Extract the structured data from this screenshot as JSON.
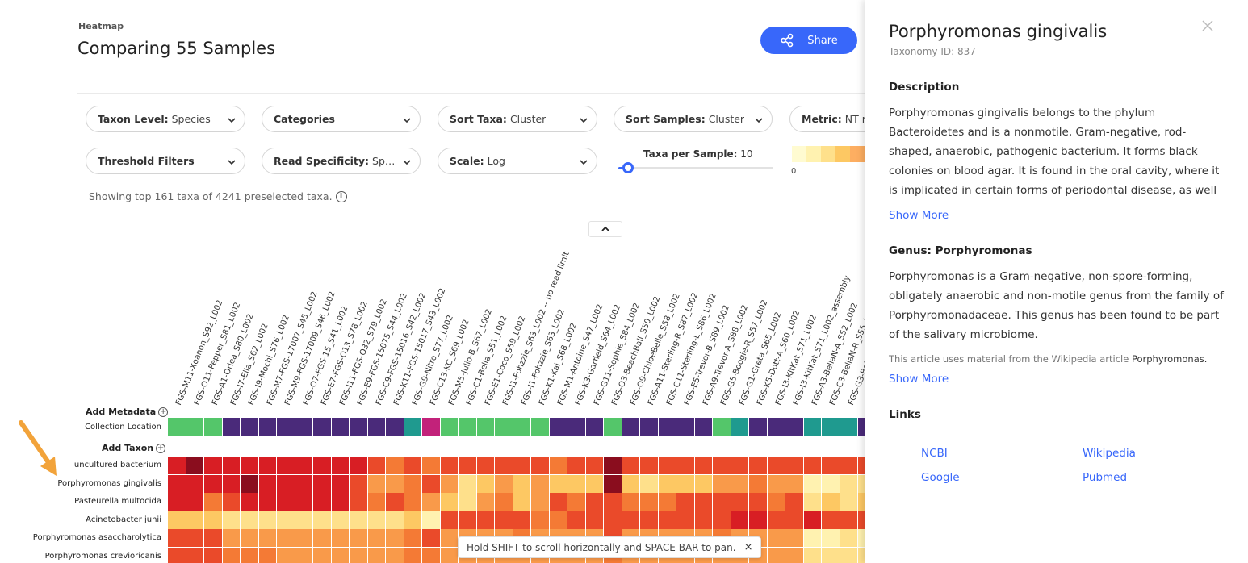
{
  "header": {
    "section_label": "Heatmap",
    "title": "Comparing 55 Samples",
    "share_label": "Share"
  },
  "controls": {
    "row1": [
      {
        "label": "Taxon Level:",
        "value": "Species"
      },
      {
        "label": "Categories",
        "value": ""
      },
      {
        "label": "Sort Taxa:",
        "value": "Cluster"
      },
      {
        "label": "Sort Samples:",
        "value": "Cluster"
      },
      {
        "label": "Metric:",
        "value": "NT r"
      }
    ],
    "row2": [
      {
        "label": "Threshold Filters",
        "value": ""
      },
      {
        "label": "Read Specificity:",
        "value": "Spec…"
      },
      {
        "label": "Scale:",
        "value": "Log"
      }
    ],
    "slider": {
      "label": "Taxa per Sample:",
      "value": "10"
    },
    "scale_zero": "0",
    "scale_colors": [
      "#fffbd1",
      "#fff2b0",
      "#fee08b",
      "#fdc863",
      "#fdae61",
      "#f98d52"
    ],
    "showing_text": "Showing top 161 taxa of 4241 preselected taxa."
  },
  "heatmap": {
    "add_metadata_label": "Add Metadata",
    "add_taxon_label": "Add Taxon",
    "metadata_row_label": "Collection Location",
    "samples": [
      "FGS-M11-Xoanon_S92_L002",
      "FGS-O11-Pepper_S81_L002",
      "FGS-A1-Orlea_S80_L002",
      "FGS-I7-Ella_S62_L002",
      "FGS-I9-Mochi_S76_L002",
      "FGS-M7-FGS-17007_S45_L002",
      "FGS-M9-FGS-17009_S46_L002",
      "FGS-O7-FGS-15_S41_L002",
      "FGS-E7-FGS-O13_S78_L002",
      "FGS-I11-FGS-O32_S79_L002",
      "FGS-E9-FGS-15075_S44_L002",
      "FGS-C9-FGS-15016_S42_L002",
      "FGS-K11-FGS-15017_S43_L002",
      "FGS-G9-Nitro_S77_L002",
      "FGS-C13-KC_S69_L002",
      "FGS-M5-Julio-B_S67_L002",
      "FGS-C1-Bella_S51_L002",
      "FGS-E1-Coco_S59_L002",
      "FGS-I1-Fohzzie_S63_L002 -- no read limit",
      "FGS-I1-Fohzzie_S63_L002",
      "FGS-K1-Kai_S68_L002",
      "FGS-M1-Antoine_S47_L002",
      "FGS-K3-Garfield_S64_L002",
      "FGS-G11-Sophie_S84_L002",
      "FGS-O3-BeachBall_S50_L002",
      "FGS-O9-ChloeBelle_S58_L002",
      "FGS-A11-Sterling-R_S87_L002",
      "FGS-C11-Sterling-L_S86_L002",
      "FGS-E5-Trevor-B_S89_L002",
      "FGS-A9-Trevor-A_S88_L002",
      "FGS-G5-Boogie-R_S57_L002",
      "FGS-G1-Greta_S65_L002",
      "FGS-K5-Dott-A_S60_L002",
      "FGS-I3-KitKat_S71_L002",
      "FGS-I3-KitKat_S71_L002_assembly",
      "FGS-A3-BellaN-A_S52_L002",
      "FGS-C3-BellaN-R_S55_L002",
      "FGS-G3-BellaN"
    ],
    "metadata_colors": [
      "#54c66a",
      "#54c66a",
      "#54c66a",
      "#4a2a7a",
      "#4a2a7a",
      "#4a2a7a",
      "#4a2a7a",
      "#4a2a7a",
      "#4a2a7a",
      "#4a2a7a",
      "#4a2a7a",
      "#4a2a7a",
      "#4a2a7a",
      "#1f9a8f",
      "#c2227a",
      "#54c66a",
      "#54c66a",
      "#54c66a",
      "#54c66a",
      "#54c66a",
      "#54c66a",
      "#4a2a7a",
      "#4a2a7a",
      "#4a2a7a",
      "#54c66a",
      "#4a2a7a",
      "#4a2a7a",
      "#4a2a7a",
      "#4a2a7a",
      "#4a2a7a",
      "#54c66a",
      "#1f9a8f",
      "#4a2a7a",
      "#4a2a7a",
      "#4a2a7a",
      "#1f9a8f",
      "#1f9a8f",
      "#1f9a8f",
      "#4a2a7a"
    ],
    "taxa": [
      {
        "name": "uncultured bacterium",
        "levels": [
          7,
          8,
          7,
          7,
          7,
          7,
          7,
          7,
          7,
          7,
          7,
          6,
          5,
          6,
          5,
          6,
          6,
          6,
          6,
          6,
          6,
          5,
          6,
          6,
          8,
          6,
          6,
          6,
          6,
          6,
          6,
          6,
          6,
          6,
          6,
          6,
          6,
          6,
          6
        ]
      },
      {
        "name": "Porphyromonas gingivalis",
        "levels": [
          7,
          7,
          7,
          7,
          8,
          7,
          7,
          7,
          7,
          7,
          6,
          4,
          4,
          5,
          6,
          4,
          2,
          3,
          4,
          3,
          4,
          3,
          3,
          3,
          8,
          3,
          2,
          3,
          3,
          3,
          4,
          4,
          5,
          4,
          4,
          1,
          1,
          2,
          2
        ]
      },
      {
        "name": "Pasteurella multocida",
        "levels": [
          7,
          7,
          5,
          6,
          7,
          7,
          7,
          7,
          7,
          7,
          6,
          5,
          6,
          5,
          4,
          3,
          2,
          4,
          5,
          3,
          4,
          6,
          5,
          6,
          6,
          5,
          5,
          5,
          6,
          6,
          6,
          6,
          6,
          5,
          6,
          2,
          3,
          2,
          3
        ]
      },
      {
        "name": "Acinetobacter junii",
        "levels": [
          3,
          3,
          3,
          2,
          2,
          2,
          2,
          2,
          2,
          2,
          2,
          2,
          2,
          3,
          1,
          6,
          6,
          6,
          6,
          6,
          5,
          5,
          6,
          6,
          6,
          6,
          6,
          6,
          6,
          6,
          6,
          7,
          7,
          6,
          6,
          7,
          6,
          6,
          6
        ]
      },
      {
        "name": "Porphyromonas asaccharolytica",
        "levels": [
          6,
          6,
          6,
          4,
          4,
          4,
          4,
          4,
          4,
          4,
          4,
          4,
          4,
          5,
          6,
          4,
          4,
          4,
          4,
          5,
          4,
          4,
          4,
          4,
          6,
          4,
          4,
          4,
          4,
          4,
          5,
          4,
          4,
          4,
          4,
          1,
          1,
          2,
          1
        ]
      },
      {
        "name": "Porphyromonas crevioricanis",
        "levels": [
          6,
          6,
          6,
          5,
          5,
          5,
          4,
          4,
          4,
          4,
          4,
          4,
          4,
          5,
          5,
          4,
          4,
          4,
          4,
          4,
          4,
          4,
          4,
          4,
          5,
          4,
          4,
          4,
          4,
          4,
          4,
          4,
          4,
          4,
          4,
          2,
          2,
          2,
          2
        ]
      }
    ],
    "level_colors": [
      "#fffbd1",
      "#fff2b0",
      "#fee08b",
      "#fdc863",
      "#f99a4a",
      "#f47a35",
      "#ea4a2a",
      "#d81e24",
      "#8a0d1e"
    ]
  },
  "toast": {
    "text": "Hold SHIFT to scroll horizontally and SPACE BAR to pan.",
    "close": "×"
  },
  "panel": {
    "title": "Porphyromonas gingivalis",
    "taxonomy_id": "Taxonomy ID: 837",
    "description_heading": "Description",
    "description_text": "Porphyromonas gingivalis belongs to the phylum Bacteroidetes and is a nonmotile, Gram-negative, rod-shaped, anaerobic, pathogenic bacterium. It forms black colonies on blood agar. It is found in the oral cavity, where it is implicated in certain forms of periodontal disease, as well as in the upper",
    "show_more_1": "Show More",
    "genus_heading": "Genus: Porphyromonas",
    "genus_text": "Porphyromonas is a Gram-negative, non-spore-forming, obligately anaerobic and non-motile genus from the family of Porphyromonadaceae. This genus has been found to be part of the salivary microbiome.",
    "wiki_note_prefix": "This article uses material from the Wikipedia article ",
    "wiki_note_link": "Porphyromonas.",
    "show_more_2": "Show More",
    "links_heading": "Links",
    "links": [
      "NCBI",
      "Wikipedia",
      "Google",
      "Pubmed"
    ]
  }
}
